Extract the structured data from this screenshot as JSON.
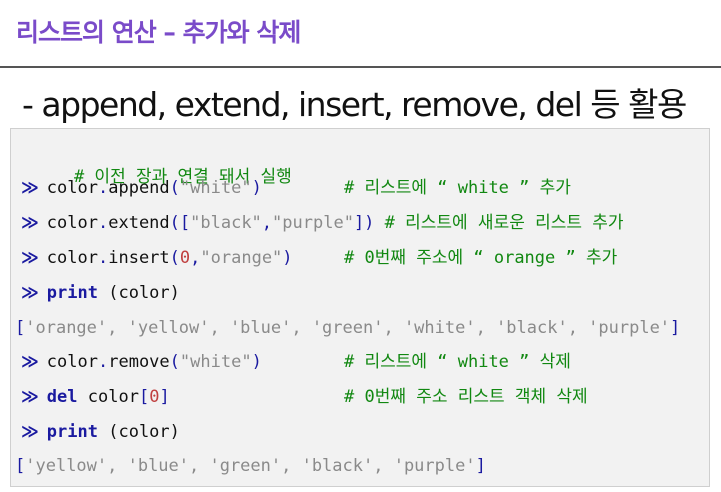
{
  "header": {
    "title": "리스트의 연산 – 추가와 삭제",
    "subtitle": "- append, extend, insert, remove, del 등 활용"
  },
  "code": {
    "prompt": "≫",
    "l1_comment": "# 이전 장과 연결 돼서 실행",
    "l2_obj": "color",
    "l2_method": "append",
    "l2_arg": "\"white\"",
    "l2_comment": "# 리스트에 “ white ” 추가",
    "l3_obj": "color",
    "l3_method": "extend",
    "l3_arg1": "\"black\"",
    "l3_arg2": "\"purple\"",
    "l3_comment": "# 리스트에 새로운 리스트 추가",
    "l4_obj": "color",
    "l4_method": "insert",
    "l4_num": "0",
    "l4_arg": "\"orange\"",
    "l4_comment": "# 0번째 주소에 “ orange ” 추가",
    "l5_kw": "print",
    "l5_arg": "(color)",
    "l6_items": "'orange', 'yellow', 'blue', 'green', 'white', 'black', 'purple'",
    "l7_obj": "color",
    "l7_method": "remove",
    "l7_arg": "\"white\"",
    "l7_comment": "# 리스트에 “ white ” 삭제",
    "l8_kw": "del",
    "l8_obj": "color",
    "l8_num": "0",
    "l8_comment": "# 0번째 주소 리스트 객체 삭제",
    "l9_kw": "print",
    "l9_arg": "(color)",
    "l10_items": "'yellow', 'blue', 'green', 'black', 'purple'"
  }
}
